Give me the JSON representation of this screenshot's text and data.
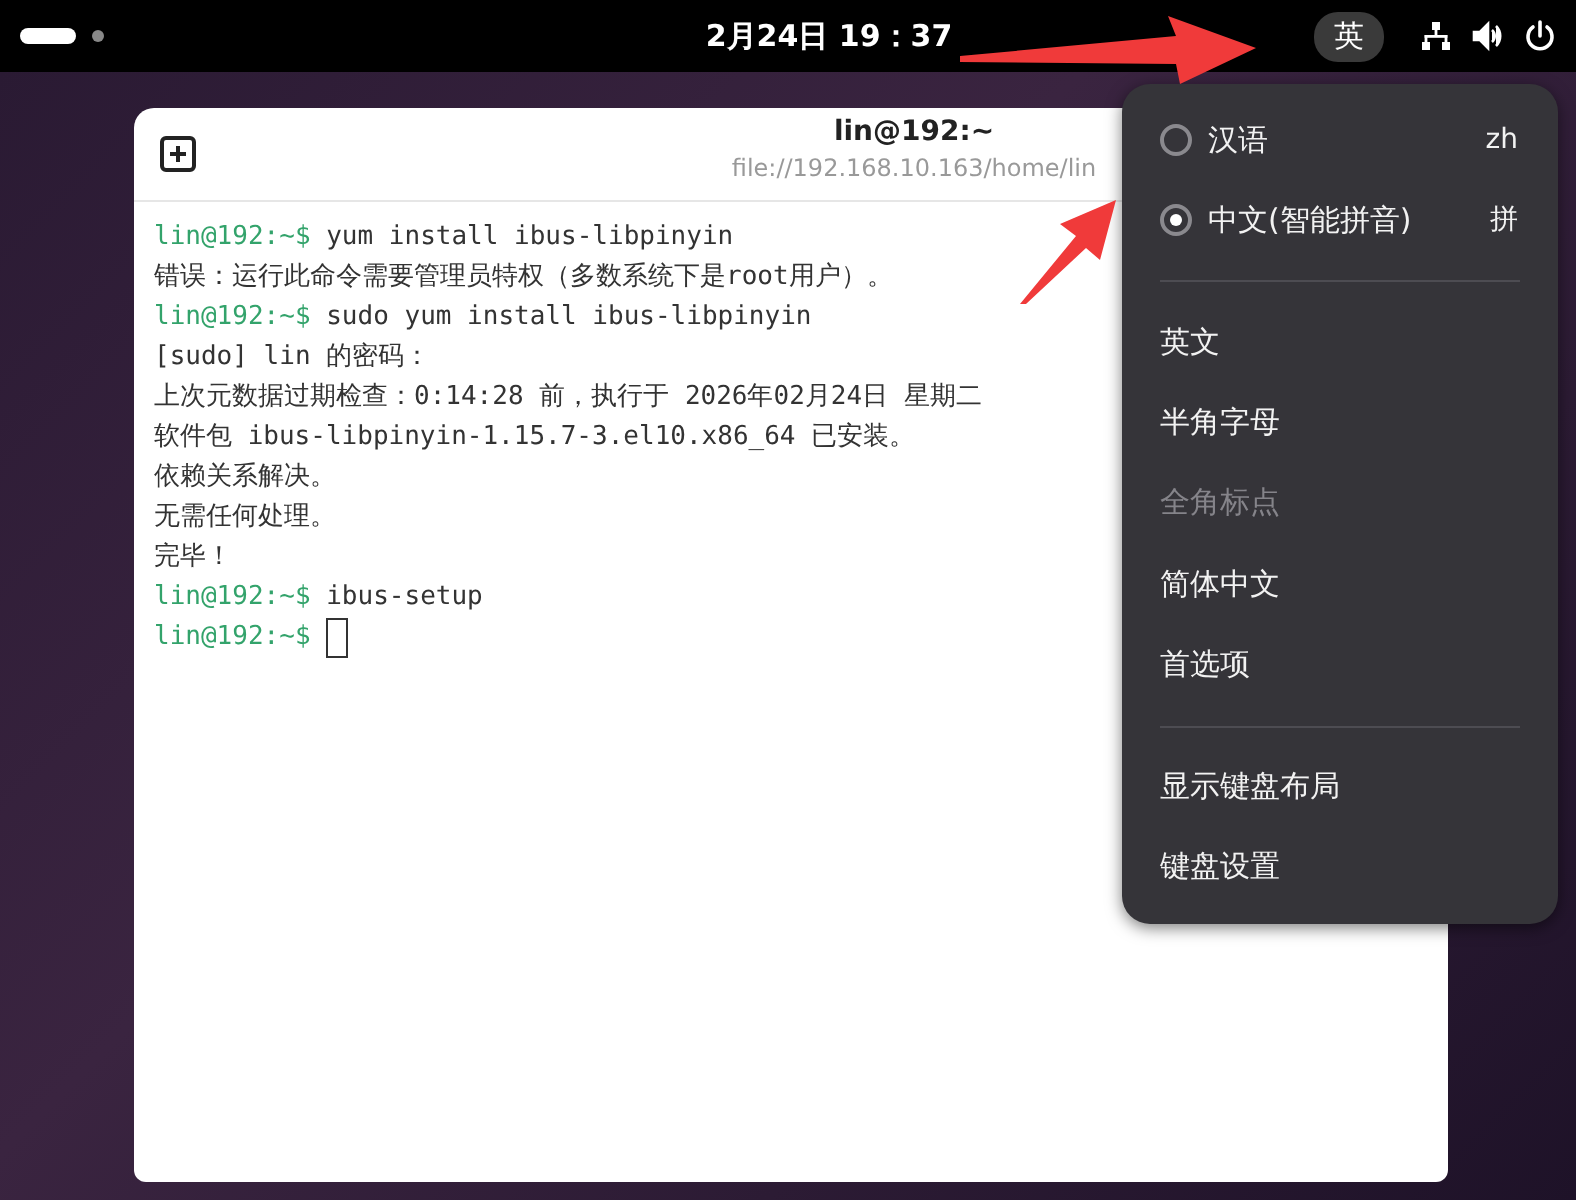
{
  "top_bar": {
    "clock": "2月24日 19：37",
    "input_indicator": "英"
  },
  "terminal": {
    "title": "lin@192:~",
    "subtitle": "file://192.168.10.163/home/lin",
    "lines": [
      {
        "kind": "prompt",
        "prompt": "lin@192:~$",
        "command": "yum install ibus-libpinyin",
        "cursor": false
      },
      {
        "kind": "output",
        "text": "错误：运行此命令需要管理员特权（多数系统下是root用户）。"
      },
      {
        "kind": "prompt",
        "prompt": "lin@192:~$",
        "command": "sudo yum install ibus-libpinyin",
        "cursor": false
      },
      {
        "kind": "output",
        "text": "[sudo] lin 的密码："
      },
      {
        "kind": "output",
        "text": "上次元数据过期检查：0:14:28 前，执行于 2026年02月24日 星期二"
      },
      {
        "kind": "output",
        "text": "软件包 ibus-libpinyin-1.15.7-3.el10.x86_64 已安装。"
      },
      {
        "kind": "output",
        "text": "依赖关系解决。"
      },
      {
        "kind": "output",
        "text": "无需任何处理。"
      },
      {
        "kind": "output",
        "text": "完毕！"
      },
      {
        "kind": "prompt",
        "prompt": "lin@192:~$",
        "command": "ibus-setup",
        "cursor": false
      },
      {
        "kind": "prompt",
        "prompt": "lin@192:~$",
        "cursor": true
      }
    ]
  },
  "input_menu": {
    "engines": [
      {
        "label": "汉语",
        "short": "zh",
        "selected": false
      },
      {
        "label": "中文(智能拼音)",
        "short": "拼",
        "selected": true
      }
    ],
    "options": [
      {
        "label": "英文",
        "disabled": false
      },
      {
        "label": "半角字母",
        "disabled": false
      },
      {
        "label": "全角标点",
        "disabled": true
      },
      {
        "label": "简体中文",
        "disabled": false
      },
      {
        "label": "首选项",
        "disabled": false
      }
    ],
    "actions": [
      {
        "label": "显示键盘布局"
      },
      {
        "label": "键盘设置"
      }
    ]
  }
}
